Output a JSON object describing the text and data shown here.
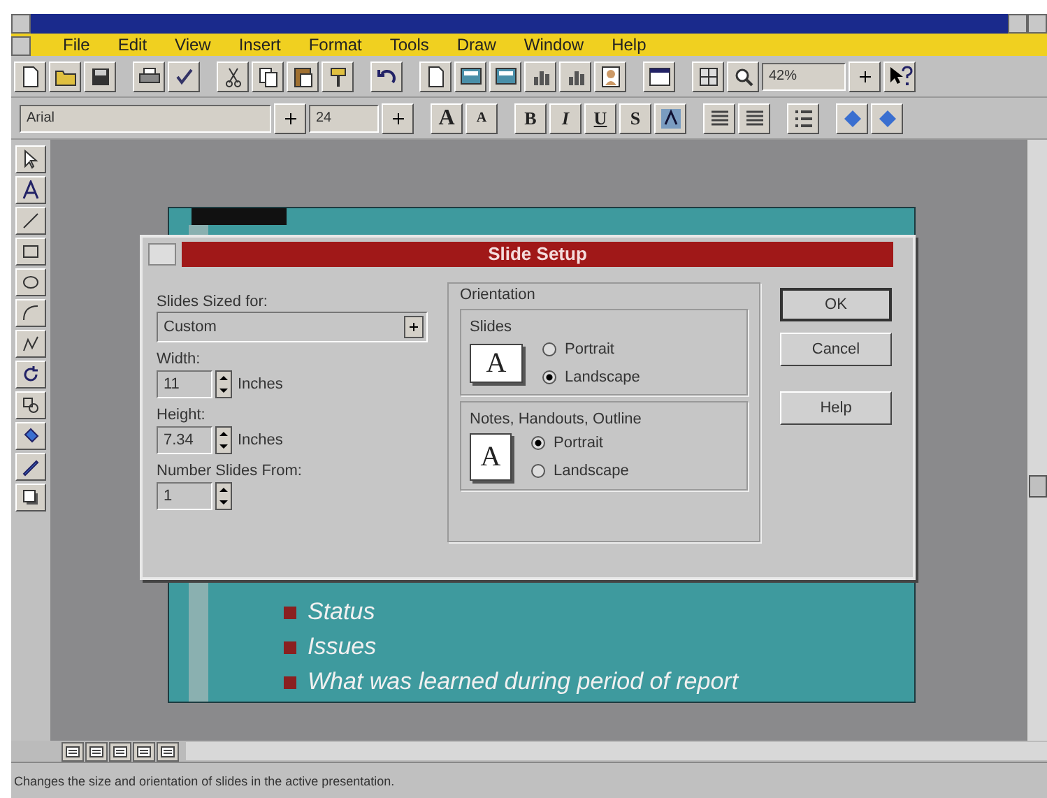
{
  "menu": [
    {
      "label": "File"
    },
    {
      "label": "Edit"
    },
    {
      "label": "View"
    },
    {
      "label": "Insert"
    },
    {
      "label": "Format"
    },
    {
      "label": "Tools"
    },
    {
      "label": "Draw"
    },
    {
      "label": "Window"
    },
    {
      "label": "Help"
    }
  ],
  "toolbar": {
    "zoom": "42%"
  },
  "formatting": {
    "font": "Arial",
    "size": "24",
    "grow": "A",
    "shrink": "A",
    "styles": [
      "B",
      "I",
      "U",
      "S"
    ]
  },
  "slide": {
    "bullets": [
      "Status",
      "Issues",
      "What was learned during period of report"
    ]
  },
  "dialog": {
    "title": "Slide Setup",
    "sized_for": {
      "label": "Slides Sized for:",
      "value": "Custom"
    },
    "fields": [
      {
        "label": "Width:",
        "value": "11",
        "unit": "Inches"
      },
      {
        "label": "Height:",
        "value": "7.34",
        "unit": "Inches"
      },
      {
        "label": "Number Slides From:",
        "value": "1"
      }
    ],
    "orientation": {
      "label": "Orientation",
      "groups": [
        {
          "title": "Slides",
          "letter": "A",
          "kind": "landscape",
          "options": [
            {
              "label": "Portrait",
              "selected": false
            },
            {
              "label": "Landscape",
              "selected": true
            }
          ]
        },
        {
          "title": "Notes, Handouts, Outline",
          "letter": "A",
          "kind": "portrait",
          "options": [
            {
              "label": "Portrait",
              "selected": true
            },
            {
              "label": "Landscape",
              "selected": false
            }
          ]
        }
      ]
    },
    "buttons": [
      "OK",
      "Cancel",
      "Help"
    ]
  },
  "status_bar": "Changes the size and orientation of slides in the active presentation."
}
